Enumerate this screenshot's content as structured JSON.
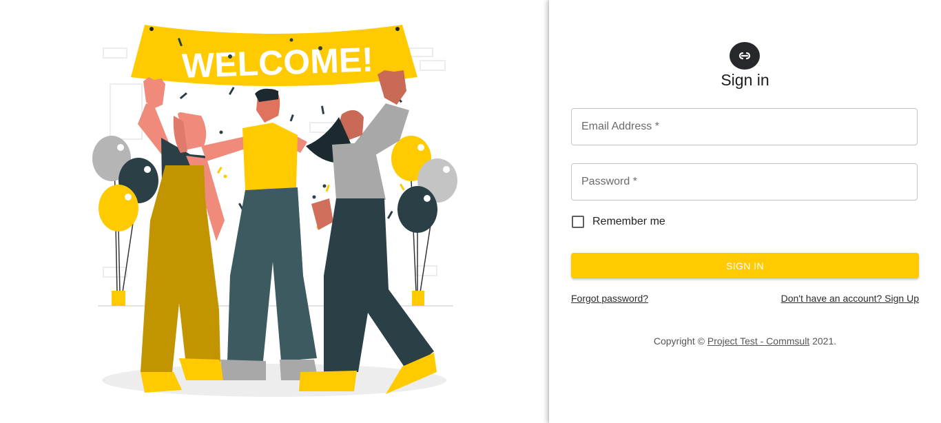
{
  "illustration": {
    "banner_text": "WELCOME!",
    "colors": {
      "yellow": "#ffca00",
      "dark_teal": "#2b3f47",
      "mustard": "#c19400",
      "skin": "#f08a7a",
      "grey": "#a8a8a8"
    }
  },
  "signin": {
    "logo_icon": "infinity-link-icon",
    "title": "Sign in",
    "email": {
      "placeholder": "Email Address *",
      "value": ""
    },
    "password": {
      "placeholder": "Password *",
      "value": ""
    },
    "remember_label": "Remember me",
    "remember_checked": false,
    "button_label": "SIGN IN",
    "forgot_link": "Forgot password?",
    "signup_link": "Don't have an account? Sign Up",
    "copyright_prefix": "Copyright ©",
    "copyright_link": "Project Test - Commsult",
    "copyright_suffix": "2021.",
    "accent_color": "#ffca00"
  }
}
